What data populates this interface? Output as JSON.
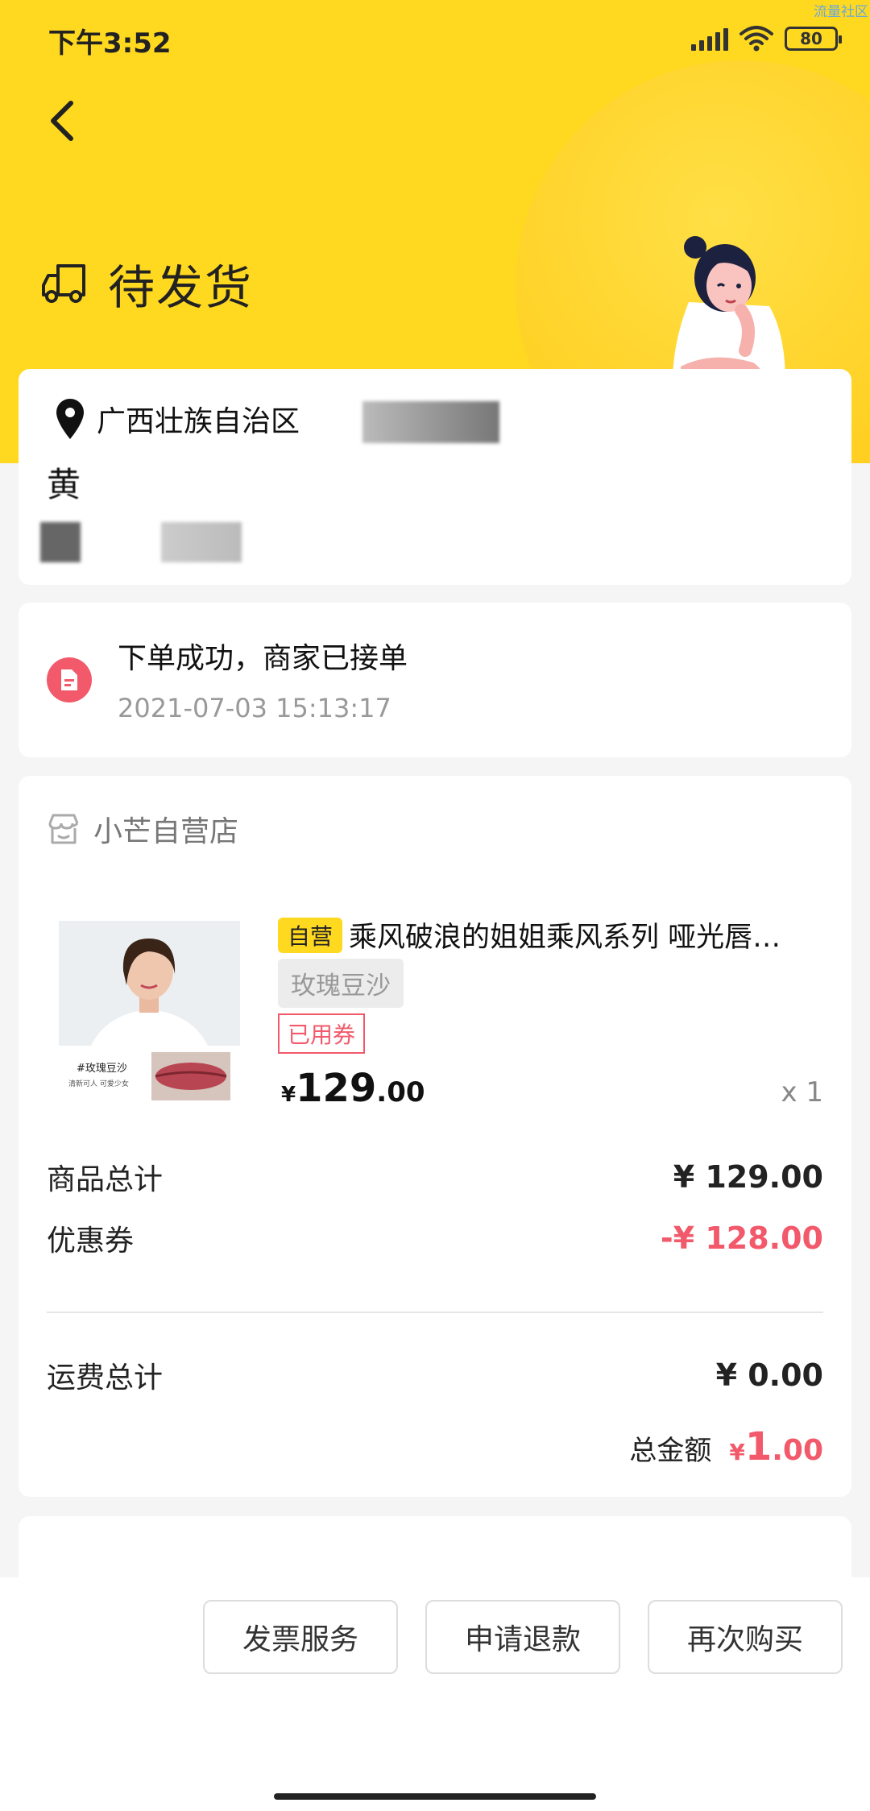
{
  "status_bar": {
    "time": "下午3:52",
    "battery": "80",
    "watermark": "流量社区"
  },
  "header": {
    "title": "待发货",
    "background_color": "#ffd820"
  },
  "address": {
    "region": "广西壮族自治区",
    "name_initial": "黄"
  },
  "order_status": {
    "title": "下单成功，商家已接单",
    "time": "2021-07-03 15:13:17",
    "icon": "document-icon"
  },
  "store": {
    "name": "小芒自营店"
  },
  "product": {
    "tag": "自营",
    "title": "乘风破浪的姐姐乘风系列 哑光唇…",
    "variant": "玫瑰豆沙",
    "coupon_tag": "已用券",
    "price_currency": "¥",
    "price_integer": "129",
    "price_decimal": ".00",
    "quantity": "x 1",
    "image_caption": "#玫瑰豆沙",
    "image_subcaption": "清新可人 可爱少女"
  },
  "summary": {
    "goods_total_label": "商品总计",
    "goods_total_value": "¥ 129.00",
    "coupon_label": "优惠券",
    "coupon_value": "-¥ 128.00",
    "shipping_label": "运费总计",
    "shipping_value": "¥ 0.00",
    "grand_total_label": "总金额",
    "grand_total_currency": "¥",
    "grand_total_integer": "1",
    "grand_total_decimal": ".00"
  },
  "actions": {
    "invoice": "发票服务",
    "refund": "申请退款",
    "rebuy": "再次购买"
  },
  "colors": {
    "accent_yellow": "#ffd820",
    "accent_red": "#f25a6b"
  }
}
